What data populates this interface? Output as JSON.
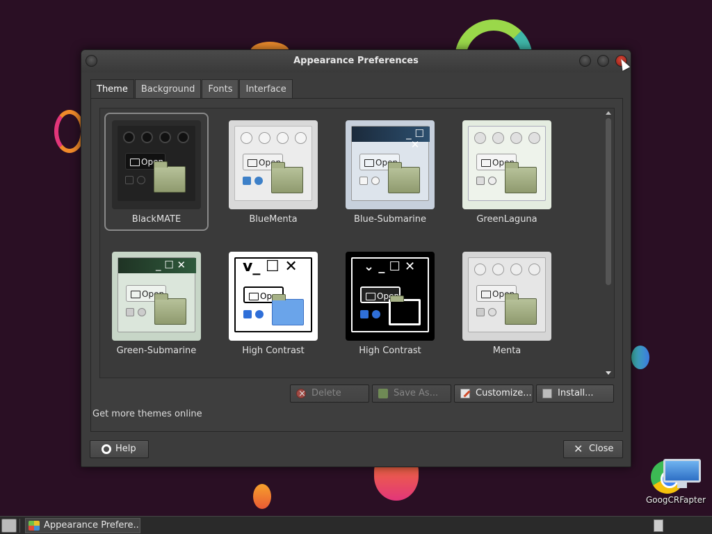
{
  "window": {
    "title": "Appearance Preferences"
  },
  "tabs": [
    {
      "label": "Theme",
      "active": true
    },
    {
      "label": "Background",
      "active": false
    },
    {
      "label": "Fonts",
      "active": false
    },
    {
      "label": "Interface",
      "active": false
    }
  ],
  "themes": [
    {
      "name": "BlackMATE",
      "selected": true
    },
    {
      "name": "BlueMenta",
      "selected": false
    },
    {
      "name": "Blue-Submarine",
      "selected": false
    },
    {
      "name": "GreenLaguna",
      "selected": false
    },
    {
      "name": "Green-Submarine",
      "selected": false
    },
    {
      "name": "High Contrast",
      "selected": false
    },
    {
      "name": "High Contrast",
      "selected": false
    },
    {
      "name": "Menta",
      "selected": false
    }
  ],
  "thumb_text": {
    "open": "Open"
  },
  "actions": {
    "delete": "Delete",
    "save_as": "Save As...",
    "customize": "Customize...",
    "install": "Install..."
  },
  "get_more_link": "Get more themes online",
  "footer": {
    "help": "Help",
    "close": "Close"
  },
  "taskbar": {
    "task_label": "Appearance Prefere..."
  },
  "desktop": {
    "icon_label": "GoogCRFapter"
  },
  "colors": {
    "close_button": "#e04a3a",
    "accent_green": "#9ad84a"
  }
}
